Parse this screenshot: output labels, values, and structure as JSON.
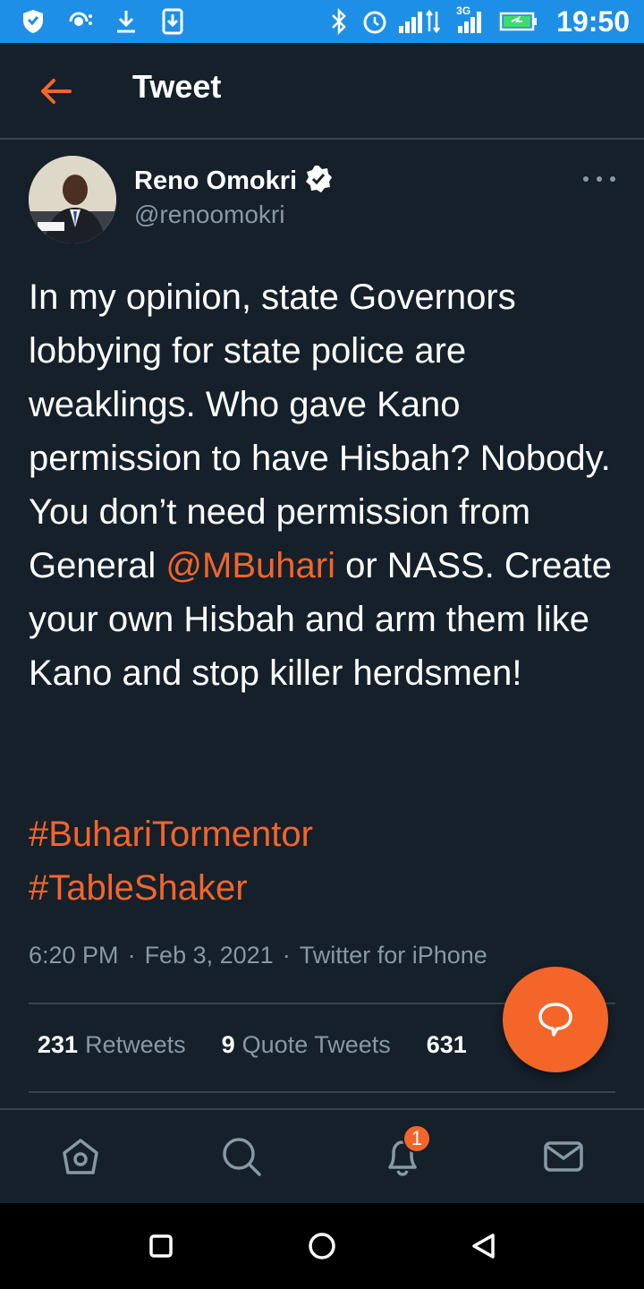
{
  "status_bar": {
    "time": "19:50",
    "network_label": "3G"
  },
  "header": {
    "title": "Tweet"
  },
  "tweet": {
    "author_name": "Reno Omokri",
    "author_handle": "@renoomokri",
    "text_part1": "In my opinion, state Governors lobbying for state police are weaklings. Who gave Kano permission to have Hisbah? Nobody. You don’t need permission from General ",
    "mention": "@MBuhari",
    "text_part2": " or NASS. Create your own Hisbah and arm them like Kano and stop killer herdsmen!",
    "hashtags": [
      "#BuhariTormentor",
      "#TableShaker"
    ],
    "time": "6:20 PM",
    "date": "Feb 3, 2021",
    "source": "Twitter for iPhone",
    "sep": "·"
  },
  "stats": {
    "retweets_count": "231",
    "retweets_label": "Retweets",
    "quotes_count": "9",
    "quotes_label": "Quote Tweets",
    "likes_count": "631"
  },
  "tabbar": {
    "notification_badge": "1"
  },
  "colors": {
    "accent": "#f4652a",
    "background": "#15202b",
    "status_bar": "#1e8fe6",
    "secondary_text": "#8899a6",
    "divider": "#38444d"
  }
}
